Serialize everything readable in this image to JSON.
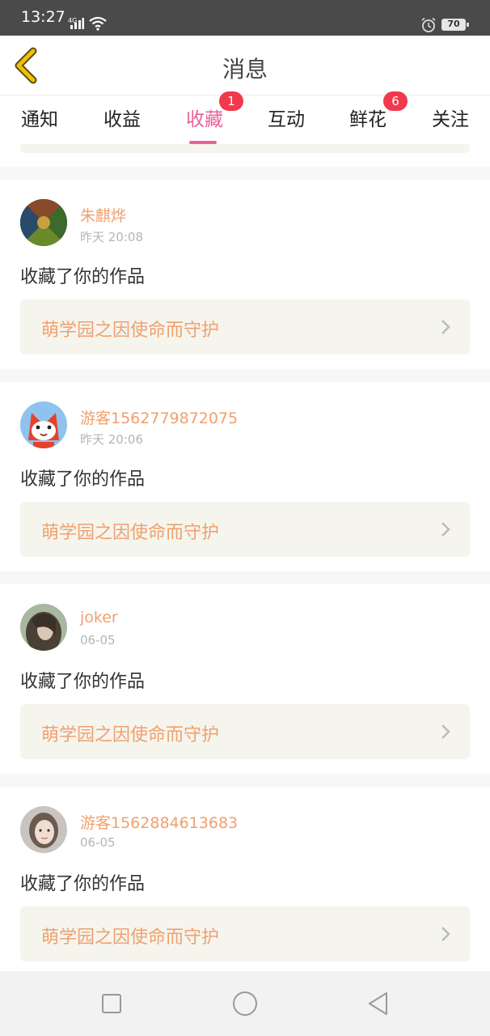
{
  "status_bar": {
    "time": "13:27",
    "network": "4G",
    "battery": "70",
    "icons": [
      "signal-icon",
      "wifi-icon",
      "alarm-icon",
      "battery-icon"
    ]
  },
  "header": {
    "title": "消息",
    "back_icon": "chevron-left-icon",
    "accent_color": "#f2c200"
  },
  "tabs": [
    {
      "label": "通知",
      "active": false
    },
    {
      "label": "收益",
      "active": false
    },
    {
      "label": "收藏",
      "active": true,
      "badge": "1"
    },
    {
      "label": "互动",
      "active": false
    },
    {
      "label": "鲜花",
      "active": false,
      "badge": "6"
    },
    {
      "label": "关注",
      "active": false
    }
  ],
  "colors": {
    "active_tab": "#e8619a",
    "badge": "#f2384d",
    "username": "#f0a06e",
    "link_bg": "#f5f5ee"
  },
  "messages": [
    {
      "user": "朱麒烨",
      "time": "昨天 20:08",
      "action": "收藏了你的作品",
      "work": "萌学园之因使命而守护"
    },
    {
      "user": "游客1562779872075",
      "time": "昨天 20:06",
      "action": "收藏了你的作品",
      "work": "萌学园之因使命而守护"
    },
    {
      "user": "joker",
      "time": "06-05",
      "action": "收藏了你的作品",
      "work": "萌学园之因使命而守护"
    },
    {
      "user": "游客1562884613683",
      "time": "06-05",
      "action": "收藏了你的作品",
      "work": "萌学园之因使命而守护"
    }
  ],
  "nav_bar": {
    "buttons": [
      "recents-square-icon",
      "home-circle-icon",
      "back-triangle-icon"
    ]
  }
}
